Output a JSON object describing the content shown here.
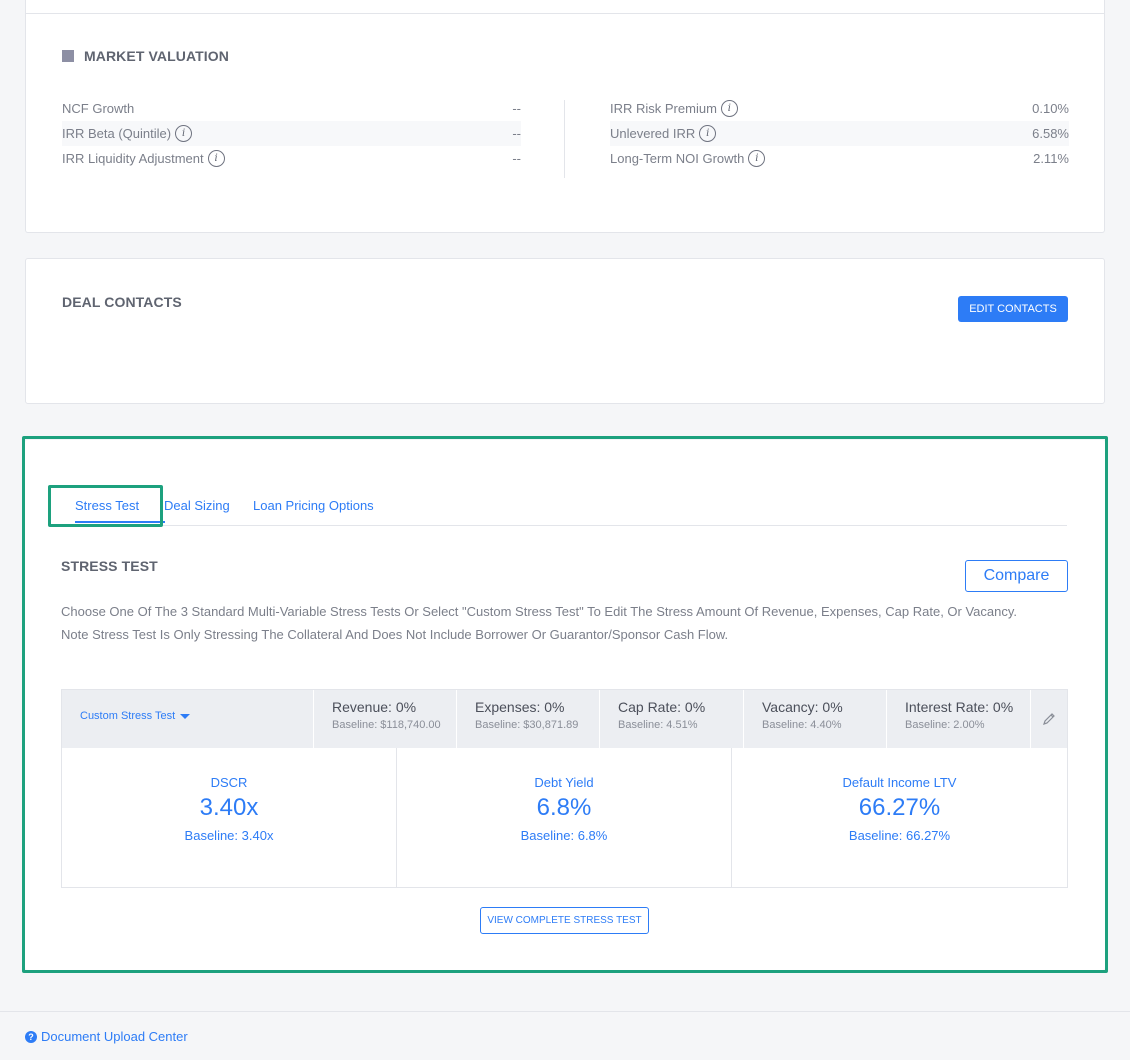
{
  "market_valuation": {
    "title": "MARKET VALUATION",
    "left_rows": [
      {
        "label": "NCF Growth",
        "value": "--",
        "info": false
      },
      {
        "label": "IRR Beta (Quintile)",
        "value": "--",
        "info": true
      },
      {
        "label": "IRR Liquidity Adjustment",
        "value": "--",
        "info": true
      }
    ],
    "right_rows": [
      {
        "label": "IRR Risk Premium",
        "value": "0.10%",
        "info": true
      },
      {
        "label": "Unlevered IRR",
        "value": "6.58%",
        "info": true
      },
      {
        "label": "Long-Term NOI Growth",
        "value": "2.11%",
        "info": true
      }
    ]
  },
  "deal_contacts": {
    "title": "DEAL CONTACTS",
    "edit_button": "EDIT CONTACTS"
  },
  "stress_tabs": {
    "tabs": [
      "Stress Test",
      "Deal Sizing",
      "Loan Pricing Options"
    ],
    "active": "Stress Test"
  },
  "stress_test": {
    "title": "STRESS TEST",
    "compare_button": "Compare",
    "description_line1": "Choose One Of The 3 Standard Multi-Variable Stress Tests Or Select \"Custom Stress Test\" To Edit The Stress Amount Of Revenue, Expenses, Cap Rate, Or Vacancy.",
    "description_line2": "Note Stress Test Is Only Stressing The Collateral And Does Not Include Borrower Or Guarantor/Sponsor Cash Flow.",
    "selector": "Custom Stress Test",
    "variables": [
      {
        "label": "Revenue: 0%",
        "baseline": "Baseline: $118,740.00"
      },
      {
        "label": "Expenses: 0%",
        "baseline": "Baseline: $30,871.89"
      },
      {
        "label": "Cap Rate: 0%",
        "baseline": "Baseline: 4.51%"
      },
      {
        "label": "Vacancy: 0%",
        "baseline": "Baseline: 4.40%"
      },
      {
        "label": "Interest Rate: 0%",
        "baseline": "Baseline: 2.00%"
      }
    ],
    "metrics": [
      {
        "label": "DSCR",
        "value": "3.40x",
        "baseline": "Baseline: 3.40x"
      },
      {
        "label": "Debt Yield",
        "value": "6.8%",
        "baseline": "Baseline: 6.8%"
      },
      {
        "label": "Default Income LTV",
        "value": "66.27%",
        "baseline": "Baseline: 66.27%"
      }
    ],
    "view_button": "VIEW COMPLETE STRESS TEST"
  },
  "footer": {
    "link": "Document Upload Center"
  },
  "colors": {
    "accent": "#2d7cf6",
    "highlight": "#1da17e"
  }
}
